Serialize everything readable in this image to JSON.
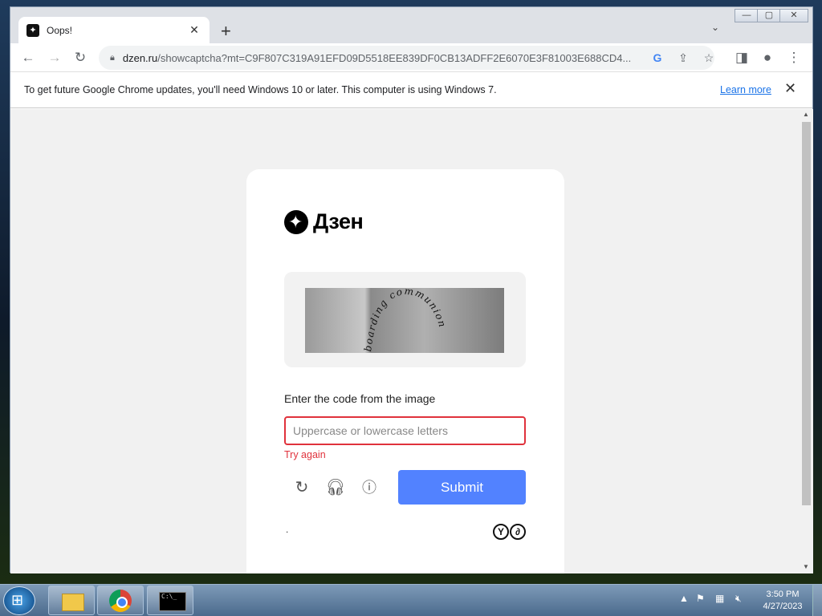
{
  "browser": {
    "tab": {
      "title": "Oops!",
      "favicon": "dzen-star-icon"
    },
    "new_tab_label": "+",
    "url_domain": "dzen.ru",
    "url_path": "/showcaptcha?mt=C9F807C319A91EFD09D5518EE839DF0CB13ADFF2E6070E3F81003E688CD4...",
    "omnibox_g": "G"
  },
  "infobar": {
    "message": "To get future Google Chrome updates, you'll need Windows 10 or later. This computer is using Windows 7.",
    "link": "Learn more"
  },
  "page": {
    "logo_text": "Дзен",
    "captcha_text": "boarding communion",
    "prompt": "Enter the code from the image",
    "input_placeholder": "Uppercase or lowercase letters",
    "input_value": "",
    "error": "Try again",
    "submit_label": "Submit",
    "footer_dot": ".",
    "badge_y": "Y",
    "badge_d": "∂"
  },
  "taskbar": {
    "time": "3:50 PM",
    "date": "4/27/2023"
  },
  "colors": {
    "accent": "#5282ff",
    "error": "#e0323c",
    "link": "#1a73e8"
  }
}
